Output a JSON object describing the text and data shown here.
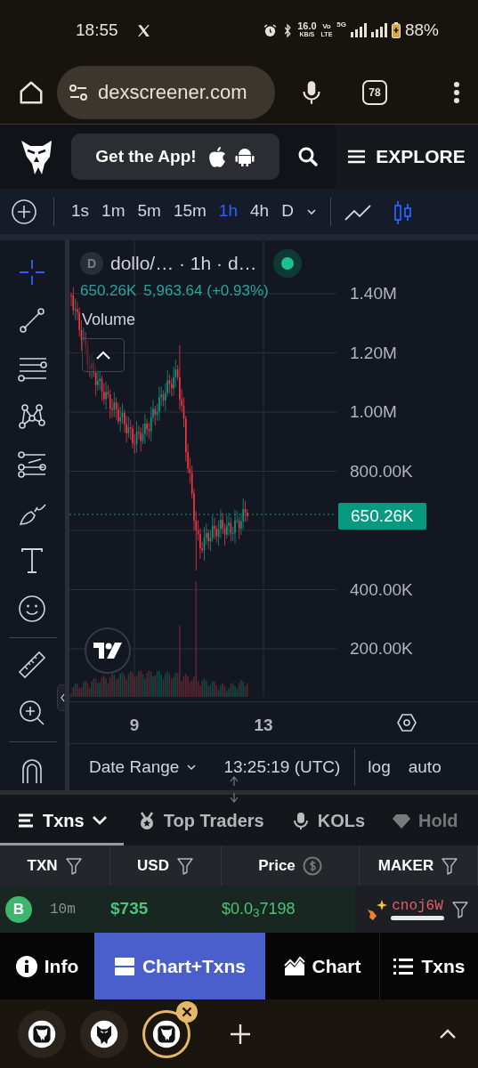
{
  "status_bar": {
    "time": "18:55",
    "speed": "16.0",
    "speed_unit": "KB/S",
    "volte_top": "Vo",
    "volte_bottom": "LTE",
    "network": "5G",
    "battery": "88%"
  },
  "browser": {
    "url": "dexscreener.com",
    "tab_count": "78"
  },
  "header": {
    "app_button": "Get the App!",
    "explore": "EXPLORE"
  },
  "toolbar": {
    "timeframes": [
      {
        "label": "1s",
        "selected": false
      },
      {
        "label": "1m",
        "selected": false
      },
      {
        "label": "5m",
        "selected": false
      },
      {
        "label": "15m",
        "selected": false
      },
      {
        "label": "1h",
        "selected": true
      },
      {
        "label": "4h",
        "selected": false
      },
      {
        "label": "D",
        "selected": false
      }
    ],
    "chart_types": [
      {
        "kind": "line",
        "selected": false
      },
      {
        "kind": "candles",
        "selected": true
      }
    ]
  },
  "drawing_tools": [
    {
      "selected": true
    },
    {
      "selected": false
    },
    {
      "selected": false
    },
    {
      "selected": false
    },
    {
      "selected": false
    },
    {
      "selected": false
    },
    {
      "selected": false
    },
    {
      "selected": false
    },
    {
      "selected": false
    },
    {
      "selected": false
    },
    {
      "selected": false
    }
  ],
  "chart": {
    "avatar": "D",
    "title": "dollo/… · 1h · d…",
    "last": "650.26K",
    "change": "5,963.64 (+0.93%)",
    "indicator": "Volume",
    "y_labels": [
      "1.40M",
      "1.20M",
      "1.00M",
      "800.00K",
      "400.00K",
      "200.00K"
    ],
    "price_tag": "650.26K",
    "x_labels": [
      "9",
      "13"
    ],
    "date_range": "Date Range",
    "clock": "13:25:19 (UTC)",
    "log": "log",
    "auto": "auto"
  },
  "tabs": [
    {
      "label": "Txns",
      "selected": true
    },
    {
      "label": "Top Traders",
      "selected": false
    },
    {
      "label": "KOLs",
      "selected": false
    },
    {
      "label": "Hold",
      "selected": false
    }
  ],
  "table": {
    "columns": [
      "TXN",
      "USD",
      "Price",
      "MAKER"
    ],
    "rows": [
      {
        "side": "B",
        "age": "10m",
        "usd": "$735",
        "price": "$0.0$_{3}$7198",
        "maker": "cnoj6W"
      }
    ]
  },
  "bottom_nav": [
    {
      "label": "Info",
      "selected": false
    },
    {
      "label": "Chart+Txns",
      "selected": true
    },
    {
      "label": "Chart",
      "selected": false
    },
    {
      "label": "Txns",
      "selected": false
    }
  ],
  "browser_tabs": [
    {
      "selected": false
    },
    {
      "selected": false
    },
    {
      "selected": true
    }
  ]
}
